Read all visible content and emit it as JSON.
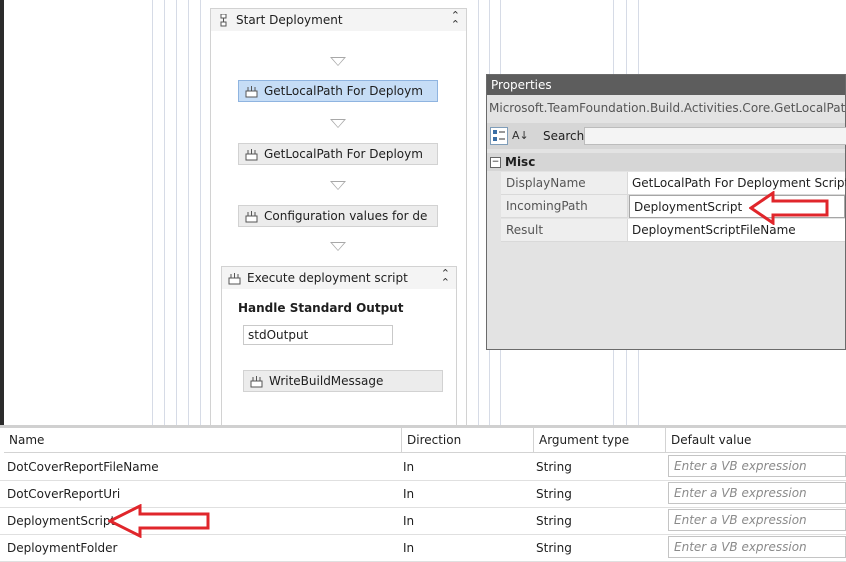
{
  "designer": {
    "sequence_title": "Start Deployment",
    "activities": [
      {
        "label": "GetLocalPath For Deploym",
        "selected": true
      },
      {
        "label": "GetLocalPath For Deploym",
        "selected": false
      },
      {
        "label": "Configuration values for de",
        "selected": false
      }
    ],
    "inner_sequence_title": "Execute deployment script",
    "handle_output_label": "Handle Standard Output",
    "handle_output_value": "stdOutput",
    "inner_activity": "WriteBuildMessage"
  },
  "properties": {
    "title": "Properties",
    "type_name": "Microsoft.TeamFoundation.Build.Activities.Core.GetLocalPath",
    "search_label": "Search:",
    "category": "Misc",
    "rows": [
      {
        "name": "DisplayName",
        "value": "GetLocalPath For Deployment Script"
      },
      {
        "name": "IncomingPath",
        "value": "DeploymentScript"
      },
      {
        "name": "Result",
        "value": "DeploymentScriptFileName"
      }
    ]
  },
  "arguments": {
    "headers": [
      "Name",
      "Direction",
      "Argument type",
      "Default value"
    ],
    "rows": [
      {
        "name": "DotCoverReportFileName",
        "direction": "In",
        "type": "String",
        "default_placeholder": "Enter a VB expression"
      },
      {
        "name": "DotCoverReportUri",
        "direction": "In",
        "type": "String",
        "default_placeholder": "Enter a VB expression"
      },
      {
        "name": "DeploymentScript",
        "direction": "In",
        "type": "String",
        "default_placeholder": "Enter a VB expression"
      },
      {
        "name": "DeploymentFolder",
        "direction": "In",
        "type": "String",
        "default_placeholder": "Enter a VB expression"
      }
    ]
  },
  "annotation_color": "#e0262b"
}
